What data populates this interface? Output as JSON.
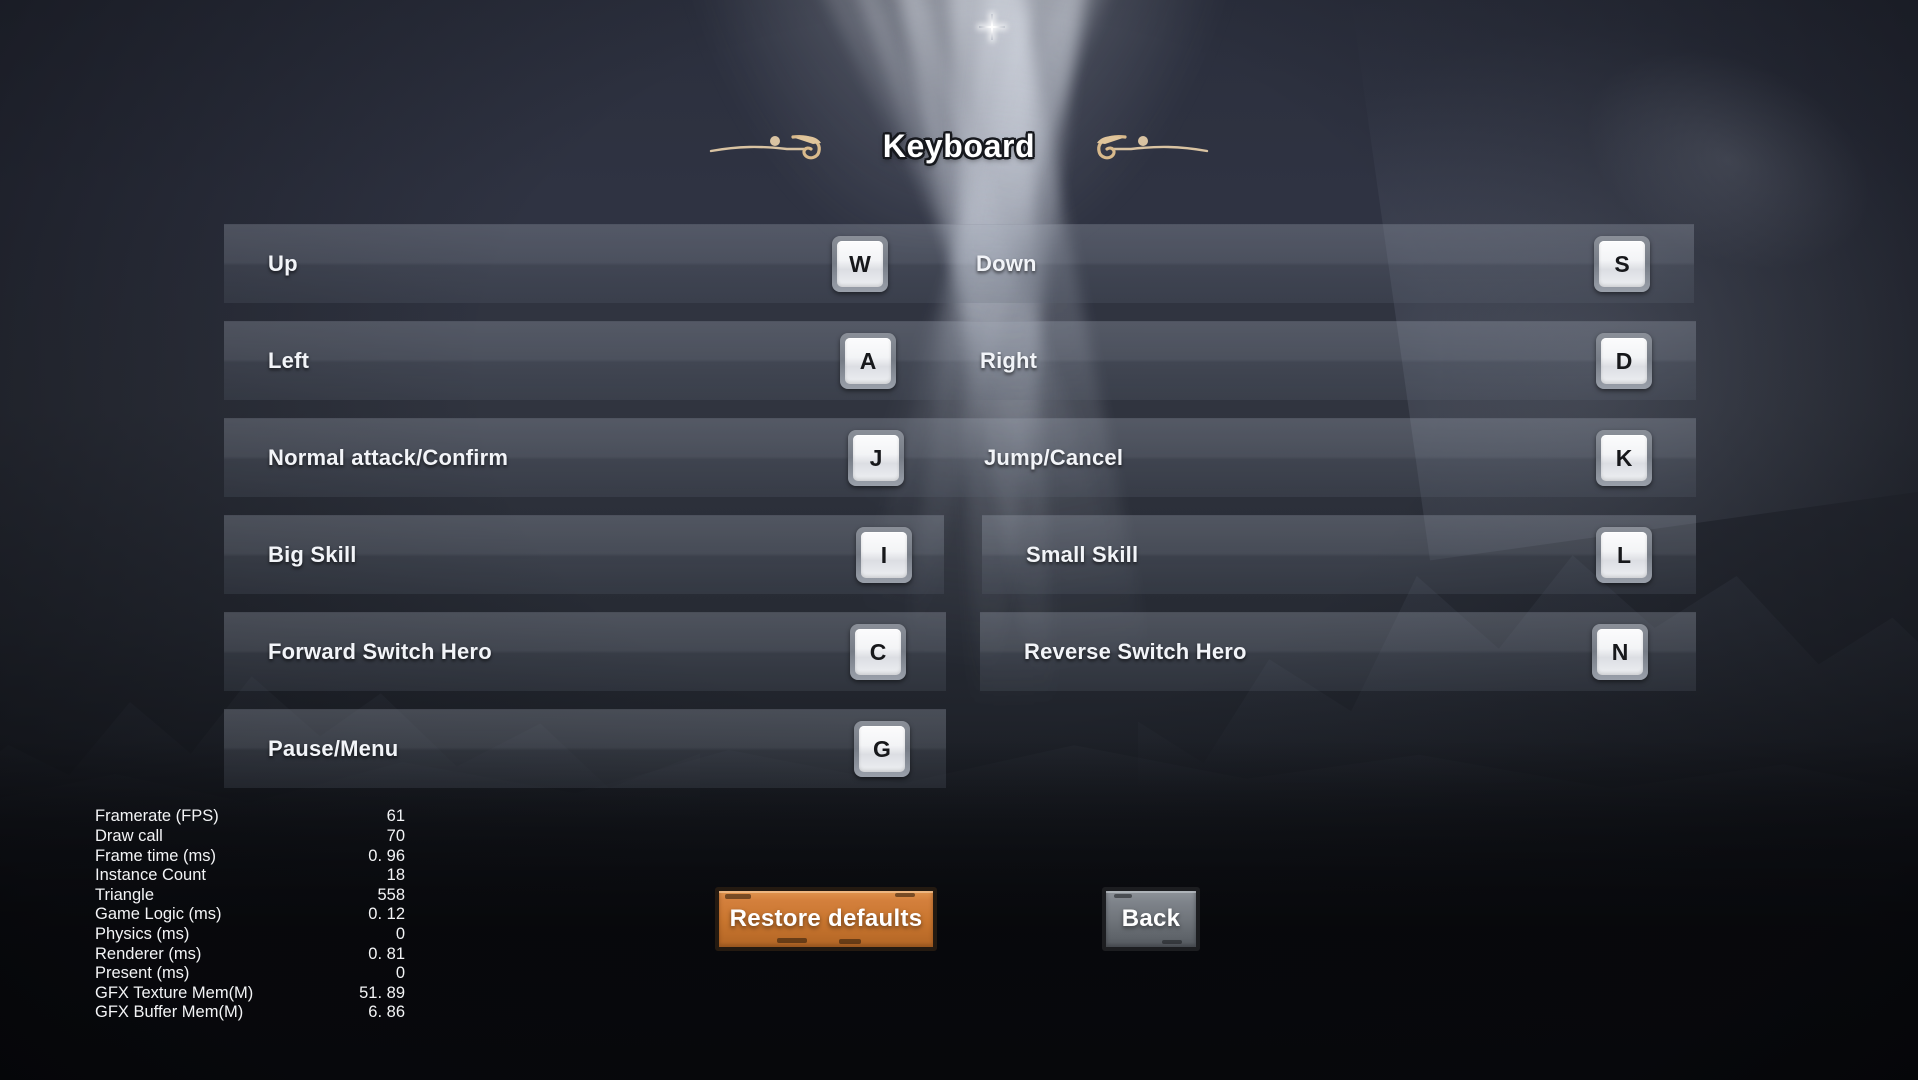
{
  "screen": {
    "title": "Keyboard",
    "ornament_left": "flourish-ornament-left",
    "ornament_right": "flourish-ornament-right"
  },
  "colors": {
    "accent_orange": "#c9762f",
    "button_gray": "#6e7379",
    "row_panel": "#9aa2b0",
    "keycap_face": "#f3f4f6",
    "text_primary": "#f2f4f8",
    "background_dark": "#2b2f3d"
  },
  "bindings": {
    "column_left": [
      {
        "action": "Up",
        "key": "W"
      },
      {
        "action": "Left",
        "key": "A"
      },
      {
        "action": "Normal attack/Confirm",
        "key": "J"
      },
      {
        "action": "Big Skill",
        "key": "I"
      },
      {
        "action": "Forward Switch Hero",
        "key": "C"
      },
      {
        "action": "Pause/Menu",
        "key": "G"
      }
    ],
    "column_right": [
      {
        "action": "Down",
        "key": "S"
      },
      {
        "action": "Right",
        "key": "D"
      },
      {
        "action": "Jump/Cancel",
        "key": "K"
      },
      {
        "action": "Small Skill",
        "key": "L"
      },
      {
        "action": "Reverse Switch Hero",
        "key": "N"
      }
    ]
  },
  "buttons": {
    "restore_defaults": "Restore defaults",
    "back": "Back"
  },
  "performance_overlay": {
    "rows": [
      {
        "label": "Framerate (FPS)",
        "value": "61"
      },
      {
        "label": "Draw call",
        "value": "70"
      },
      {
        "label": "Frame time (ms)",
        "value": "0. 96"
      },
      {
        "label": "Instance Count",
        "value": "18"
      },
      {
        "label": "Triangle",
        "value": "558"
      },
      {
        "label": "Game Logic (ms)",
        "value": "0. 12"
      },
      {
        "label": "Physics (ms)",
        "value": "0"
      },
      {
        "label": "Renderer (ms)",
        "value": "0. 81"
      },
      {
        "label": "Present (ms)",
        "value": "0"
      },
      {
        "label": "GFX Texture Mem(M)",
        "value": "51. 89"
      },
      {
        "label": "GFX Buffer Mem(M)",
        "value": "6. 86"
      }
    ]
  }
}
